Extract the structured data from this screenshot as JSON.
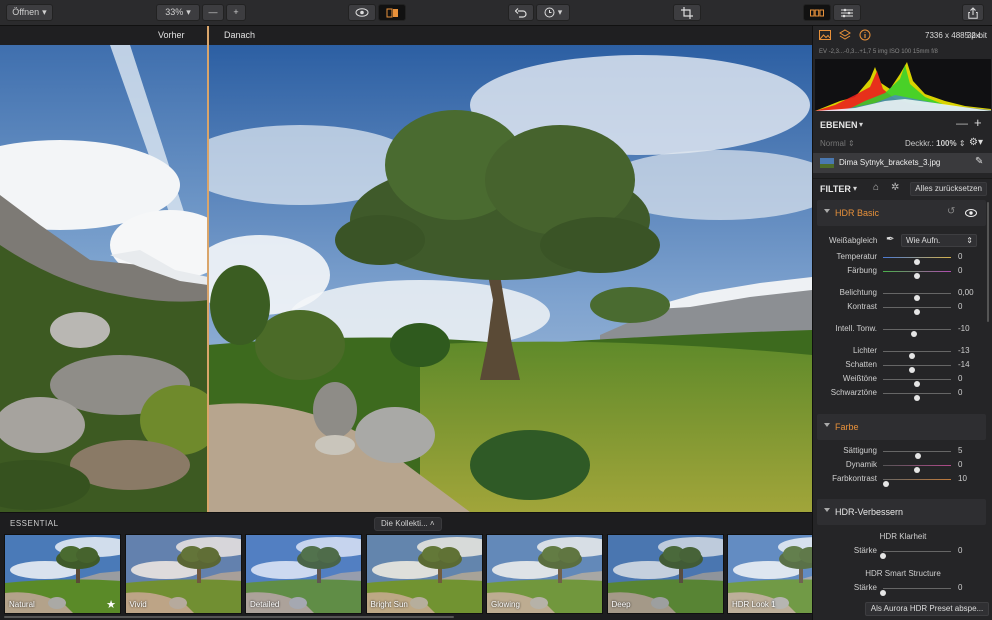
{
  "toolbar": {
    "open_label": "Öffnen",
    "zoom_value": "33%"
  },
  "canvas": {
    "before_label": "Vorher",
    "after_label": "Danach"
  },
  "presets": {
    "title": "ESSENTIAL",
    "collection_label": "Die Kollekti...",
    "items": [
      {
        "label": "Natural",
        "favorite": true
      },
      {
        "label": "Vivid"
      },
      {
        "label": "Detailed"
      },
      {
        "label": "Bright Sun"
      },
      {
        "label": "Glowing"
      },
      {
        "label": "Deep"
      },
      {
        "label": "HDR Look 1"
      }
    ]
  },
  "panel": {
    "resolution": "7336 x 4885 px",
    "bit_depth": "32-bit",
    "exif": "EV -2,3...-0,3...+1,7    5 img    ISO 100    15mm    f/8",
    "layers": {
      "title": "EBENEN",
      "blend_mode": "Normal",
      "opacity_label": "Deckkr.:",
      "opacity_value": "100%",
      "layer_name": "Dima Sytnyk_brackets_3.jpg"
    },
    "filter": {
      "title": "FILTER",
      "reset_label": "Alles zurücksetzen"
    },
    "hdr_basic": {
      "title": "HDR Basic",
      "wb_label": "Weißabgleich",
      "wb_value": "Wie Aufn.",
      "sliders": [
        {
          "label": "Temperatur",
          "value": "0",
          "pos": 0.5
        },
        {
          "label": "Färbung",
          "value": "0",
          "pos": 0.5
        },
        {
          "label": "Belichtung",
          "value": "0,00",
          "pos": 0.5
        },
        {
          "label": "Kontrast",
          "value": "0",
          "pos": 0.5
        },
        {
          "label": "Intell. Tonw.",
          "value": "-10",
          "pos": 0.45
        },
        {
          "label": "Lichter",
          "value": "-13",
          "pos": 0.43
        },
        {
          "label": "Schatten",
          "value": "-14",
          "pos": 0.43
        },
        {
          "label": "Weißtöne",
          "value": "0",
          "pos": 0.5
        },
        {
          "label": "Schwarztöne",
          "value": "0",
          "pos": 0.5
        }
      ]
    },
    "farbe": {
      "title": "Farbe",
      "sliders": [
        {
          "label": "Sättigung",
          "value": "5",
          "pos": 0.52
        },
        {
          "label": "Dynamik",
          "value": "0",
          "pos": 0.5
        },
        {
          "label": "Farbkontrast",
          "value": "10",
          "pos": 0.05
        }
      ]
    },
    "hdr_verbessern": {
      "title": "HDR-Verbessern",
      "clarity_title": "HDR Klarheit",
      "clarity_label": "Stärke",
      "clarity_value": "0",
      "smart_title": "HDR Smart Structure",
      "smart_label": "Stärke",
      "smart_value": "0"
    },
    "aurora_button": "Als Aurora HDR Preset abspe..."
  }
}
